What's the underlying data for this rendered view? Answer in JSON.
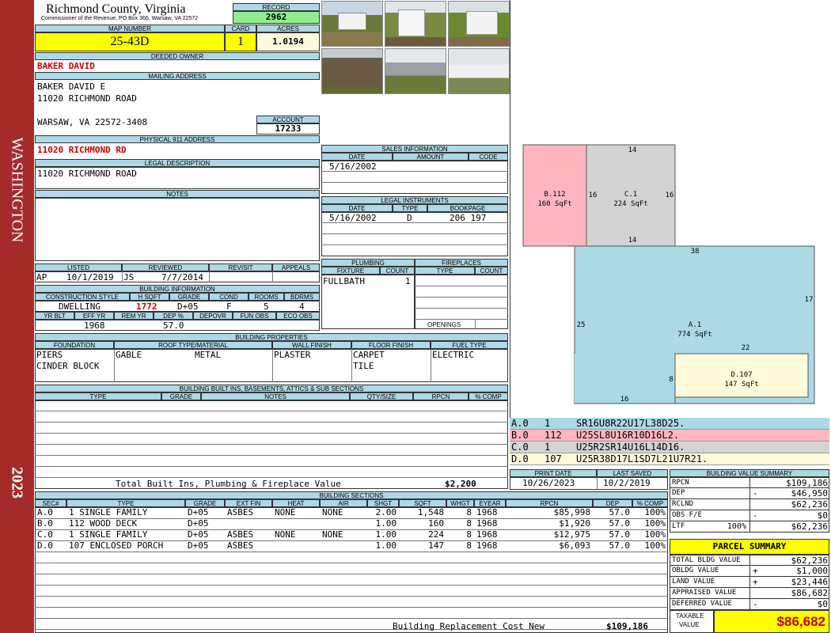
{
  "sidebar": {
    "district": "WASHINGTON",
    "year": "2023"
  },
  "header": {
    "county": "Richmond County, Virginia",
    "office": "Commissioner of the Revenue, PO Box 366, Warsaw, VA 22572",
    "record_label": "RECORD",
    "record": "2962",
    "map_label": "MAP NUMBER",
    "map": "25-43D",
    "card_label": "CARD",
    "card": "1",
    "acres_label": "ACRES",
    "acres": "1.0194"
  },
  "owner": {
    "deeded_label": "DEEDED OWNER",
    "deeded": "BAKER DAVID",
    "mailing_label": "MAILING ADDRESS",
    "mail1": "BAKER DAVID E",
    "mail2": "11020 RICHMOND ROAD",
    "mail3": "WARSAW, VA 22572-3408",
    "account_label": "ACCOUNT",
    "account": "17233",
    "physical_label": "PHYSICAL 911 ADDRESS",
    "physical": "11020 RICHMOND RD",
    "legal_label": "LEGAL DESCRIPTION",
    "legal": "11020  RICHMOND ROAD",
    "notes_label": "NOTES"
  },
  "sales": {
    "label": "SALES INFORMATION",
    "cols": [
      "DATE",
      "AMOUNT",
      "CODE"
    ],
    "rows": [
      {
        "date": "5/16/2002",
        "amount": "",
        "code": ""
      }
    ]
  },
  "instruments": {
    "label": "LEGAL INSTRUMENTS",
    "cols": [
      "DATE",
      "TYPE",
      "BOOKPAGE"
    ],
    "rows": [
      {
        "date": "5/16/2002",
        "type": "D",
        "book": "206 197"
      }
    ]
  },
  "listing": {
    "listed_label": "LISTED",
    "reviewed_label": "REVIEWED",
    "revisit_label": "REVISIT",
    "appeals_label": "APPEALS",
    "listed_by": "AP",
    "listed_date": "10/1/2019",
    "reviewed_by": "JS",
    "reviewed_date": "7/7/2014"
  },
  "building_info": {
    "label": "BUILDING INFORMATION",
    "cols": [
      "CONSTRUCTION STYLE",
      "H SQFT",
      "GRADE",
      "COND",
      "ROOMS",
      "BDRMS"
    ],
    "style": "DWELLING",
    "hsqft": "1772",
    "grade": "D+05",
    "cond": "F",
    "rooms": "5",
    "bdrms": "4",
    "cols2": [
      "YR BLT",
      "EFF YR",
      "REM YR",
      "DEP %",
      "DEPOVR",
      "FUN OBS",
      "ECO OBS"
    ],
    "yrblt": "",
    "effyr": "1968",
    "remyr": "",
    "dep": "57.0"
  },
  "plumbing": {
    "label": "PLUMBING",
    "cols": [
      "FIXTURE",
      "COUNT"
    ],
    "fixture": "FULLBATH",
    "count": "1"
  },
  "fireplaces": {
    "label": "FIREPLACES",
    "cols": [
      "TYPE",
      "COUNT"
    ],
    "openings": "OPENINGS"
  },
  "properties": {
    "label": "BUILDING PROPERTIES",
    "cols": [
      "FOUNDATION",
      "ROOF TYPE/MATERIAL",
      "WALL FINISH",
      "FLOOR FINISH",
      "FUEL TYPE"
    ],
    "f1": "PIERS",
    "f2": "CINDER BLOCK",
    "roof1": "GABLE",
    "roof2": "METAL",
    "wall": "PLASTER",
    "floor1": "CARPET",
    "floor2": "TILE",
    "fuel": "ELECTRIC"
  },
  "builtins": {
    "label": "BUILDING BUILT INS, BASEMENTS, ATTICS & SUB SECTIONS",
    "cols": [
      "TYPE",
      "GRADE",
      "NOTES",
      "QTY/SIZE",
      "RPCN",
      "% COMP"
    ],
    "total_label": "Total Built Ins, Plumbing & Fireplace Value",
    "total": "$2,200"
  },
  "dates": {
    "print_label": "PRINT DATE",
    "print": "10/26/2023",
    "saved_label": "LAST SAVED",
    "saved": "10/2/2019"
  },
  "sections": {
    "label": "BUILDING SECTIONS",
    "cols": [
      "SEC#",
      "TYPE",
      "GRADE",
      "EXT FIN",
      "HEAT",
      "AIR",
      "SHGT",
      "SQFT",
      "WHGT",
      "EYEAR",
      "RPCN",
      "DEP",
      "% COMP"
    ],
    "rows": [
      [
        "A.0",
        "1 SINGLE FAMILY",
        "D+05",
        "ASBES",
        "NONE",
        "NONE",
        "2.00",
        "1,548",
        "8",
        "1968",
        "$85,998",
        "57.0",
        "100%"
      ],
      [
        "B.0",
        "112 WOOD DECK",
        "D+05",
        "",
        "",
        "",
        "1.00",
        "160",
        "8",
        "1968",
        "$1,920",
        "57.0",
        "100%"
      ],
      [
        "C.0",
        "1 SINGLE FAMILY",
        "D+05",
        "ASBES",
        "NONE",
        "NONE",
        "1.00",
        "224",
        "8",
        "1968",
        "$12,975",
        "57.0",
        "100%"
      ],
      [
        "D.0",
        "107 ENCLOSED PORCH",
        "D+05",
        "ASBES",
        "",
        "",
        "1.00",
        "147",
        "8",
        "1968",
        "$6,093",
        "57.0",
        "100%"
      ]
    ],
    "replacement_label": "Building Replacement Cost New",
    "replacement": "$109,186"
  },
  "sketch": {
    "labels": [
      {
        "id": "B.112",
        "area": "160 SqFt"
      },
      {
        "id": "C.1",
        "area": "224 SqFt"
      },
      {
        "id": "A.1",
        "area": "774 SqFt"
      },
      {
        "id": "D.107",
        "area": "147 SqFt"
      }
    ],
    "dims": [
      "14",
      "16",
      "16",
      "14",
      "38",
      "17",
      "25",
      "22",
      "8",
      "16"
    ],
    "legend": [
      {
        "sec": "A.0",
        "code": "1",
        "path": "SR16U8R22U17L38D25.",
        "color": "#add8e6"
      },
      {
        "sec": "B.0",
        "code": "112",
        "path": "U25SL8U16R10D16L2.",
        "color": "#ffb6c1"
      },
      {
        "sec": "C.0",
        "code": "1",
        "path": "U25R2SR14U16L14D16.",
        "color": "#d3d3d3"
      },
      {
        "sec": "D.0",
        "code": "107",
        "path": "U25R38D17L1SD7L21U7R21.",
        "color": "#fffadc"
      }
    ]
  },
  "value_summary": {
    "label": "BUILDING VALUE SUMMARY",
    "rows": [
      {
        "k": "RPCN",
        "s": "",
        "v": "$109,186"
      },
      {
        "k": "DEP",
        "s": "-",
        "v": "$46,950"
      },
      {
        "k": "RCLND",
        "s": "",
        "v": "$62,236"
      },
      {
        "k": "OBS F/E",
        "s": "-",
        "v": "$0"
      },
      {
        "k": "LTF",
        "p": "100%",
        "s": "",
        "v": "$62,236"
      }
    ]
  },
  "parcel": {
    "label": "PARCEL SUMMARY",
    "rows": [
      {
        "k": "TOTAL BLDG VALUE",
        "s": "",
        "v": "$62,236"
      },
      {
        "k": "OBLDG VALUE",
        "s": "+",
        "v": "$1,000"
      },
      {
        "k": "LAND VALUE",
        "s": "+",
        "v": "$23,446"
      },
      {
        "k": "APPRAISED VALUE",
        "s": "",
        "v": "$86,682"
      },
      {
        "k": "DEFERRED VALUE",
        "s": "-",
        "v": "$0"
      }
    ],
    "taxable_label1": "TAXABLE",
    "taxable_label2": "VALUE",
    "taxable": "$86,682"
  },
  "colors": {
    "sidebar": "#a52a2a",
    "header": "#add8e6",
    "yellow": "#ffff00",
    "green": "#90ee90"
  }
}
